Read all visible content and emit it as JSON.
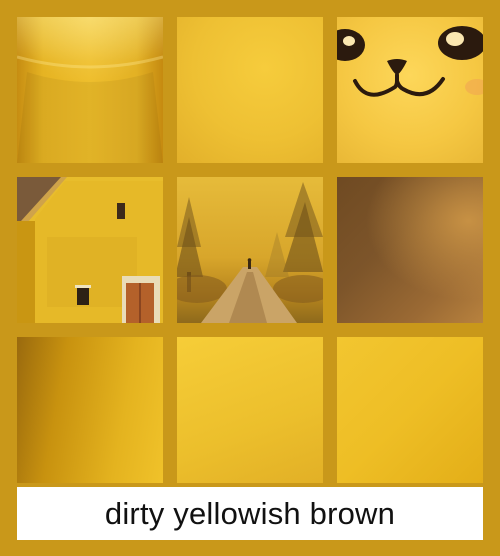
{
  "caption": {
    "text": "dirty yellowish brown"
  },
  "colors": {
    "background": "#c9991a",
    "caption_bg": "#ffffff",
    "caption_text": "#111111"
  },
  "tiles": [
    {
      "name": "silk-fabric-swatch"
    },
    {
      "name": "plain-yellow-swatch"
    },
    {
      "name": "smiling-cat-face-swatch",
      "icon": "cat-face-icon"
    },
    {
      "name": "yellow-house-swatch"
    },
    {
      "name": "foggy-forest-path-swatch"
    },
    {
      "name": "brown-texture-swatch"
    },
    {
      "name": "gradient-gold-swatch"
    },
    {
      "name": "flat-yellow-swatch"
    },
    {
      "name": "bright-yellow-swatch"
    }
  ]
}
